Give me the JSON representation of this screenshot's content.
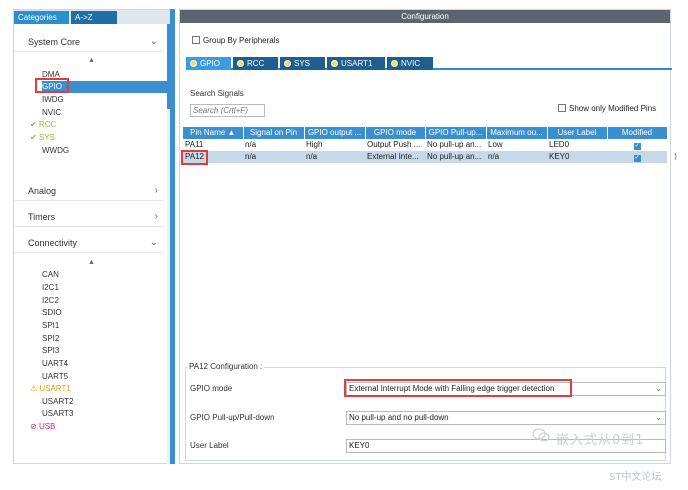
{
  "left_panel": {
    "tabs": [
      "Categories",
      "A->Z"
    ],
    "sections": {
      "system_core": {
        "title": "System Core",
        "items": [
          "DMA",
          "GPIO",
          "IWDG",
          "NVIC",
          "RCC",
          "SYS",
          "WWDG"
        ]
      },
      "analog": {
        "title": "Analog"
      },
      "timers": {
        "title": "Timers"
      },
      "connectivity": {
        "title": "Connectivity",
        "items": [
          "CAN",
          "I2C1",
          "I2C2",
          "SDIO",
          "SPI1",
          "SPI2",
          "SPI3",
          "UART4",
          "UART5",
          "USART1",
          "USART2",
          "USART3",
          "USB"
        ]
      }
    }
  },
  "right_panel": {
    "title": "Configuration",
    "group_by": "Group By Peripherals",
    "tabs": [
      "GPIO",
      "RCC",
      "SYS",
      "USART1",
      "NVIC"
    ],
    "search_label": "Search Signals",
    "search_placeholder": "Search (Crtl+F)",
    "show_modified": "Show only Modified Pins",
    "table": {
      "headers": [
        "Pin Name",
        "Signal on Pin",
        "GPIO output ...",
        "GPIO mode",
        "GPIO Pull-up...",
        "Maximum ou...",
        "User Label",
        "Modified"
      ],
      "rows": [
        [
          "PA11",
          "n/a",
          "High",
          "Output Push ...",
          "No pull-up an...",
          "Low",
          "LED0",
          "✓"
        ],
        [
          "PA12",
          "n/a",
          "n/a",
          "External Inte...",
          "No pull-up an...",
          "n/a",
          "KEY0",
          "✓"
        ]
      ]
    },
    "config": {
      "title": "PA12 Configuration :",
      "gpio_mode_label": "GPIO mode",
      "gpio_mode_value": "External Interrupt Mode with Falling edge trigger detection",
      "pull_label": "GPIO Pull-up/Pull-down",
      "pull_value": "No pull-up and no pull-down",
      "user_label_label": "User Label",
      "user_label_value": "KEY0"
    }
  },
  "watermark": {
    "main": "嵌入式从0到1",
    "sub": "ST中文论坛"
  },
  "colors": {
    "accent": "#3a8fd0",
    "highlight": "#e53b3b",
    "enabled": "#8fbf2f",
    "warning": "#e2a400",
    "disabled": "#d4237a"
  }
}
